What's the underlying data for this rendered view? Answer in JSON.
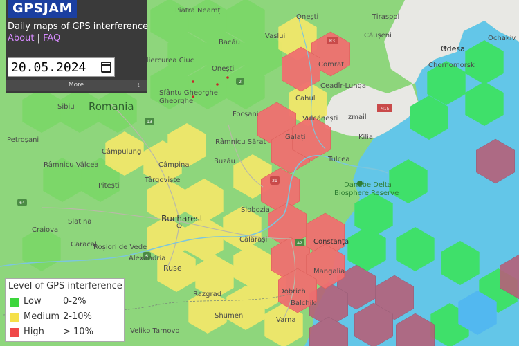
{
  "app": {
    "logo": "GPSJAM",
    "tagline": "Daily maps of GPS interference",
    "links": {
      "about": "About",
      "separator": "|",
      "faq": "FAQ"
    },
    "date": "20.05.2024",
    "more_label": "More"
  },
  "legend": {
    "title": "Level of GPS interference",
    "items": [
      {
        "label": "Low",
        "range": "0-2%",
        "color": "#3cd63c"
      },
      {
        "label": "Medium",
        "range": "2-10%",
        "color": "#f5e04a"
      },
      {
        "label": "High",
        "range": "> 10%",
        "color": "#f04848"
      }
    ]
  },
  "map": {
    "country_label": "Romania",
    "places": {
      "piatra_neamt": "Piatra Neamț",
      "onesti_n": "Onești",
      "tiraspol": "Tiraspol",
      "vaslui": "Vaslui",
      "causeni": "Căușeni",
      "ochakiv": "Ochakiv",
      "bacau": "Bacău",
      "odesa": "Odesa",
      "miercurea_ciuc": "Miercurea Ciuc",
      "onesti": "Onești",
      "comrat": "Comrat",
      "chornomorsk": "Chornomorsk",
      "ceadir_lunga": "Ceadîr-Lunga",
      "sfantu_gheorghe": "Sfântu Gheorghe",
      "cahul": "Cahul",
      "sibiu": "Sibiu",
      "focsani": "Focșani",
      "vulcanesti": "Vulcănești",
      "izmail": "Izmail",
      "galati": "Galați",
      "kilia": "Kilia",
      "petrosani": "Petroșani",
      "campulung": "Câmpulung",
      "ramnicu_sarat": "Râmnicu Sărat",
      "ramnicu_valcea": "Râmnicu Vâlcea",
      "campina": "Câmpina",
      "buzau": "Buzău",
      "tulcea": "Tulcea",
      "pitesti": "Pitești",
      "targoviste": "Târgoviște",
      "danube_delta": "Danube Delta",
      "biosphere_reserve": "Biosphere Reserve",
      "slatina": "Slatina",
      "slobozia": "Slobozia",
      "bucharest": "Bucharest",
      "craiova": "Craiova",
      "calarasi": "Călărași",
      "constanta": "Constanța",
      "caracal": "Caracal",
      "rosiori": "Roșiori de Vede",
      "alexandria": "Alexandria",
      "ruse": "Ruse",
      "mangalia": "Mangalia",
      "razgrad": "Razgrad",
      "dobrich": "Dobrich",
      "balchik": "Balchik",
      "shumen": "Shumen",
      "veliko_tarnovo": "Veliko Tarnovo",
      "varna": "Varna"
    },
    "road_shields": {
      "r3": "R3",
      "m15": "M15",
      "e2": "2",
      "e13": "13",
      "e64": "64",
      "e6": "6",
      "e21": "21",
      "a2": "A2"
    }
  }
}
